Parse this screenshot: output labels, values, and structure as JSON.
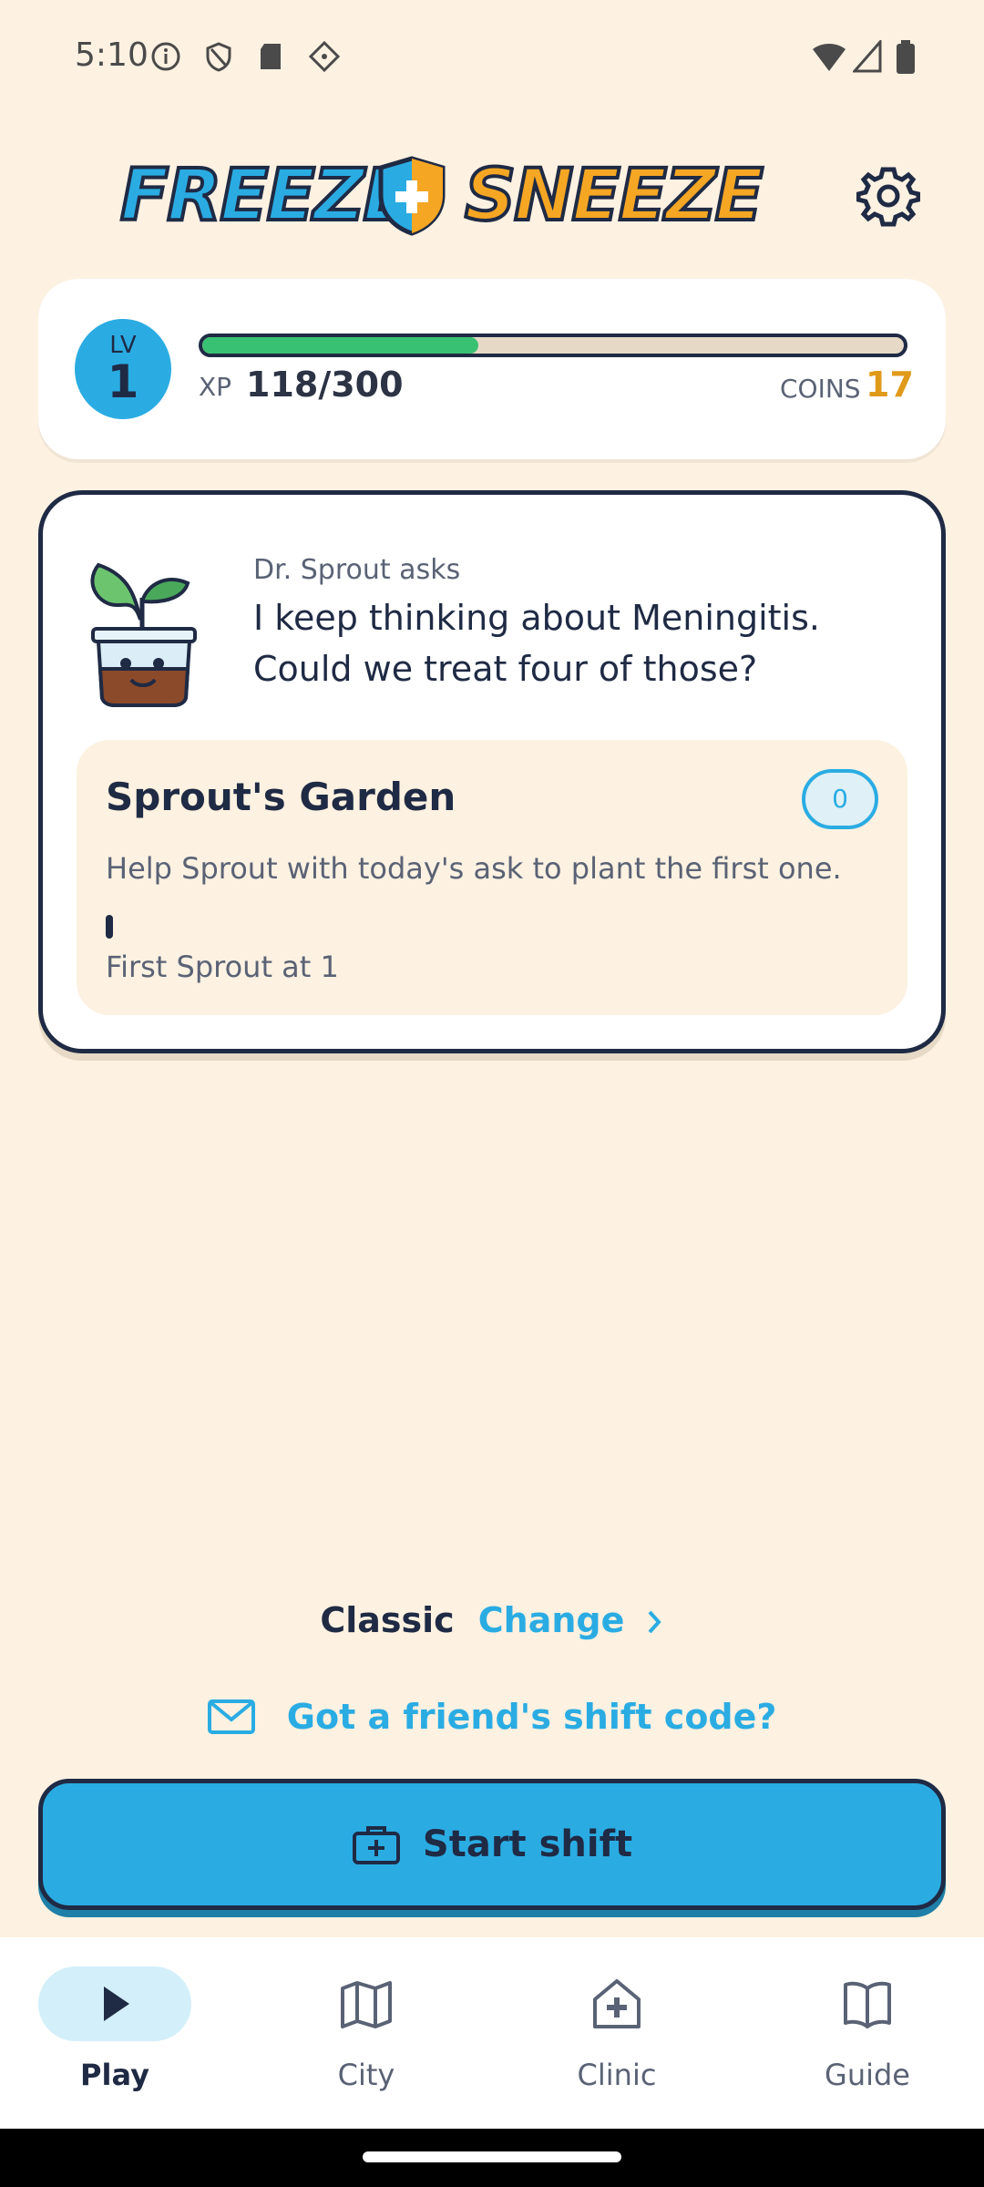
{
  "status_bar": {
    "time": "5:10"
  },
  "header": {
    "logo_left": "FREEZE",
    "logo_right": "SNEEZE"
  },
  "level": {
    "lv_label": "LV",
    "lv_value": "1",
    "xp_label": "XP",
    "xp_value": "118/300",
    "xp_progress": 0.393,
    "coins_label": "COINS",
    "coins_value": "17"
  },
  "ask": {
    "title": "Dr. Sprout asks",
    "text": "I keep thinking about Meningitis. Could we treat four of those?"
  },
  "garden": {
    "title": "Sprout's Garden",
    "count": "0",
    "description": "Help Sprout with today's ask to plant the first one.",
    "milestone": "First Sprout at 1"
  },
  "mode": {
    "name": "Classic",
    "change_label": "Change"
  },
  "shift_code": {
    "label": "Got a friend's shift code?"
  },
  "start_button": {
    "label": "Start shift"
  },
  "nav": [
    {
      "label": "Play",
      "icon": "play-icon",
      "active": true
    },
    {
      "label": "City",
      "icon": "map-icon",
      "active": false
    },
    {
      "label": "Clinic",
      "icon": "clinic-icon",
      "active": false
    },
    {
      "label": "Guide",
      "icon": "book-icon",
      "active": false
    }
  ],
  "colors": {
    "background": "#fdf1e1",
    "accent": "#2aace3",
    "xp_fill": "#38c172",
    "coins": "#e09a1a",
    "ink": "#1f2a44"
  }
}
